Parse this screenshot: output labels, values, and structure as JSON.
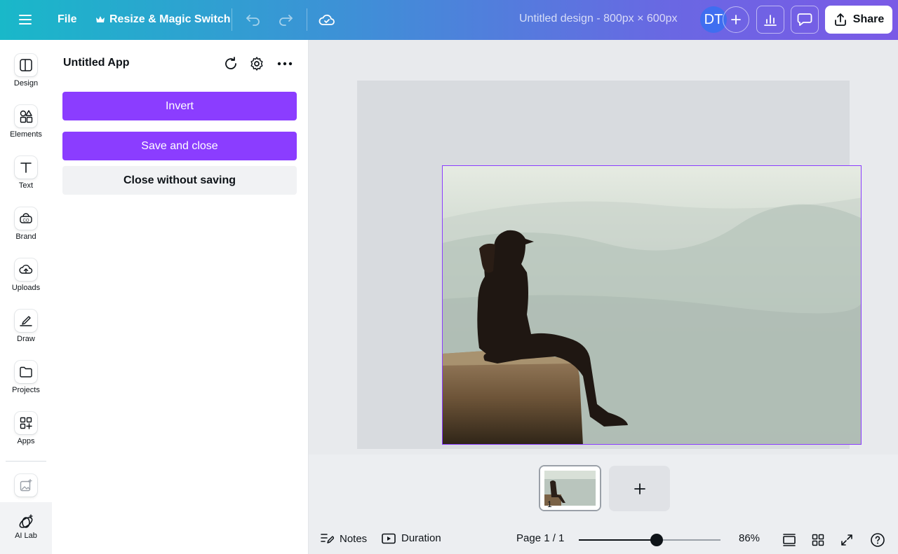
{
  "topbar": {
    "file_label": "File",
    "resize_label": "Resize & Magic Switch",
    "design_title": "Untitled design - 800px × 600px",
    "avatar_initials": "DT",
    "share_label": "Share",
    "gradient_start": "#19b8c9",
    "gradient_end": "#7a5ae6"
  },
  "rail": {
    "items": [
      {
        "label": "Design",
        "icon": "layout-icon"
      },
      {
        "label": "Elements",
        "icon": "shapes-icon"
      },
      {
        "label": "Text",
        "icon": "text-icon"
      },
      {
        "label": "Brand",
        "icon": "brand-icon"
      },
      {
        "label": "Uploads",
        "icon": "cloud-upload-icon"
      },
      {
        "label": "Draw",
        "icon": "pen-icon"
      },
      {
        "label": "Projects",
        "icon": "folder-icon"
      },
      {
        "label": "Apps",
        "icon": "apps-icon"
      }
    ],
    "ai_lab_label": "AI Lab"
  },
  "panel": {
    "title": "Untitled App",
    "invert_label": "Invert",
    "save_close_label": "Save and close",
    "close_without_label": "Close without saving",
    "accent": "#8b3dff"
  },
  "pages": {
    "thumb_number": "1"
  },
  "footer": {
    "notes_label": "Notes",
    "duration_label": "Duration",
    "page_label": "Page 1 / 1",
    "zoom_label": "86%",
    "zoom_fraction": 0.55
  }
}
